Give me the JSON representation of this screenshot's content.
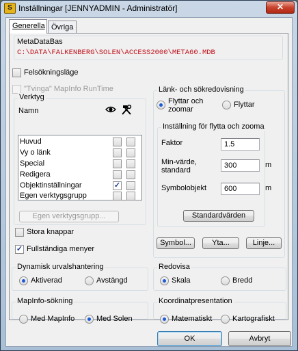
{
  "window": {
    "title": "Inställningar [JENNYADMIN - Administratör]",
    "close_label": "✕",
    "app_icon_label": "S"
  },
  "tabs": [
    {
      "label": "Generella"
    },
    {
      "label": "Övriga"
    }
  ],
  "metadatabas": {
    "title": "MetaDataBas",
    "path": "C:\\DATA\\FALKENBERG\\SOLEN\\ACCESS2000\\META60.MDB"
  },
  "felsokningslage": {
    "label": "Felsökningsläge",
    "checked": false
  },
  "tvinga": {
    "label": "\"Tvinga\" MapInfo RunTime",
    "checked": false,
    "disabled": true
  },
  "verktyg": {
    "title": "Verktyg",
    "col_namn": "Namn",
    "col_visible_icon": "eye-icon",
    "col_tool_icon": "tools-icon",
    "rows": [
      {
        "name": "Huvud",
        "visible": false,
        "tool": false
      },
      {
        "name": "Vy o länk",
        "visible": false,
        "tool": false
      },
      {
        "name": "Special",
        "visible": false,
        "tool": false
      },
      {
        "name": "Redigera",
        "visible": false,
        "tool": false
      },
      {
        "name": "Objektinställningar",
        "visible": true,
        "tool": false
      },
      {
        "name": "Egen verktygsgrupp",
        "visible": false,
        "tool": false
      }
    ],
    "egen_button": "Egen verktygsgrupp..."
  },
  "stora_knappar": {
    "label": "Stora knappar",
    "checked": false
  },
  "fullstandiga_menyer": {
    "label": "Fullständiga menyer",
    "checked": true
  },
  "lank": {
    "title": "Länk- och sökredovisning",
    "option1": "Flyttar och\nzoomar",
    "option2": "Flyttar",
    "selected": "option1"
  },
  "flytta_zooma": {
    "title": "Inställning för flytta och zooma",
    "faktor_label": "Faktor",
    "faktor_value": "1.5",
    "min_label": "Min-värde,\nstandard",
    "min_value": "300",
    "min_unit": "m",
    "symbol_label": "Symbolobjekt",
    "symbol_value": "600",
    "symbol_unit": "m",
    "std_button": "Standardvärden"
  },
  "buttons": {
    "symbol": "Symbol...",
    "yta": "Yta...",
    "linje": "Linje..."
  },
  "dynamisk": {
    "title": "Dynamisk urvalshantering",
    "option1": "Aktiverad",
    "option2": "Avstängd",
    "selected": "option1"
  },
  "redovisa": {
    "title": "Redovisa",
    "option1": "Skala",
    "option2": "Bredd",
    "selected": "option1"
  },
  "mapinfo_sok": {
    "title": "MapInfo-sökning",
    "option1": "Med MapInfo",
    "option2": "Med Solen",
    "selected": "option2"
  },
  "koordinat": {
    "title": "Koordinatpresentation",
    "option1": "Matematiskt",
    "option2": "Kartografiskt",
    "selected": "option1"
  },
  "footer": {
    "ok": "OK",
    "cancel": "Avbryt"
  }
}
